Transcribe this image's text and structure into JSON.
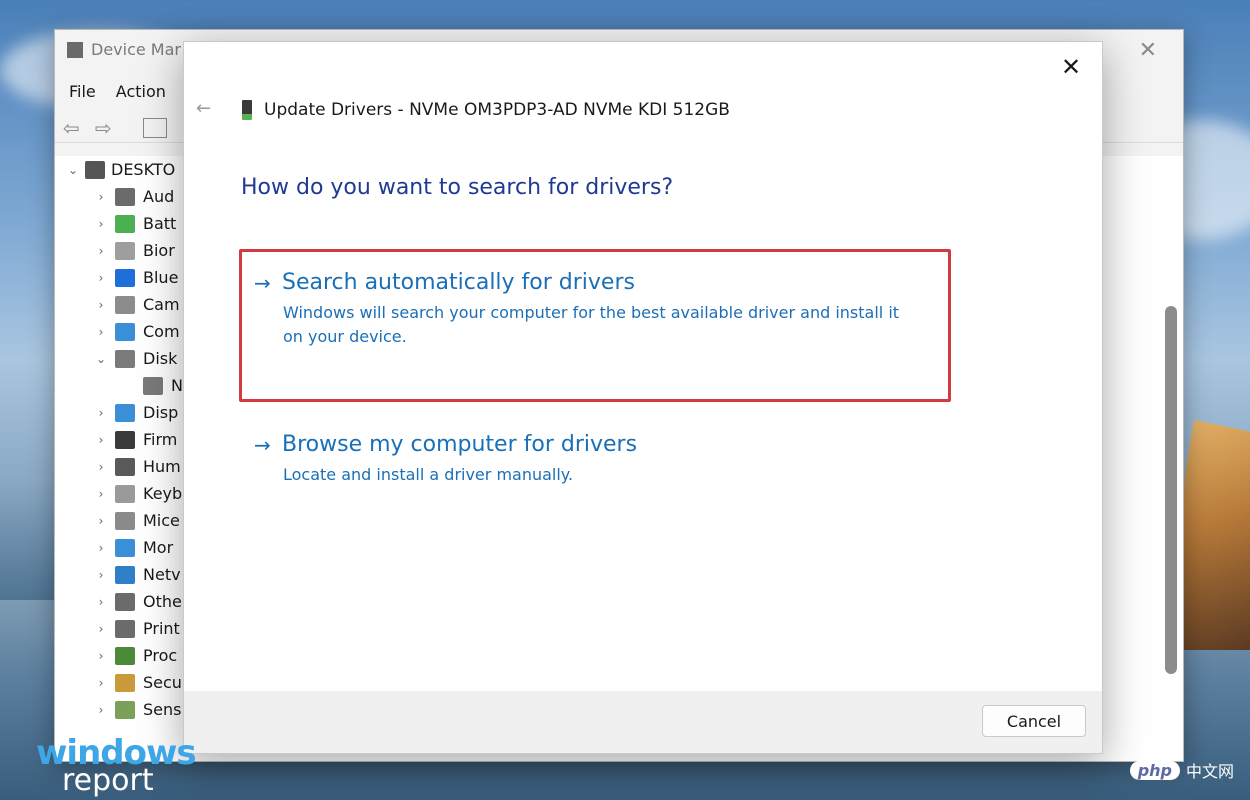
{
  "device_manager": {
    "title": "Device Mar",
    "menu": [
      "File",
      "Action"
    ],
    "tree_root": "DESKTO",
    "tree_items": [
      {
        "label": "Aud",
        "color": "#6b6b6b",
        "expanded": false
      },
      {
        "label": "Batt",
        "color": "#4caf50",
        "expanded": false
      },
      {
        "label": "Bior",
        "color": "#9e9e9e",
        "expanded": false
      },
      {
        "label": "Blue",
        "color": "#1e6fd9",
        "expanded": false
      },
      {
        "label": "Cam",
        "color": "#8c8c8c",
        "expanded": false
      },
      {
        "label": "Com",
        "color": "#3a8fd6",
        "expanded": false
      },
      {
        "label": "Disk",
        "color": "#7a7a7a",
        "expanded": true
      },
      {
        "label": "N",
        "color": "#7a7a7a",
        "expanded": false,
        "child": true
      },
      {
        "label": "Disp",
        "color": "#3a8fd6",
        "expanded": false
      },
      {
        "label": "Firm",
        "color": "#3a3a3a",
        "expanded": false
      },
      {
        "label": "Hum",
        "color": "#5a5a5a",
        "expanded": false
      },
      {
        "label": "Keyb",
        "color": "#9a9a9a",
        "expanded": false
      },
      {
        "label": "Mice",
        "color": "#8a8a8a",
        "expanded": false
      },
      {
        "label": "Mor",
        "color": "#3a8fd6",
        "expanded": false
      },
      {
        "label": "Netv",
        "color": "#2f7fc8",
        "expanded": false
      },
      {
        "label": "Othe",
        "color": "#6b6b6b",
        "expanded": false
      },
      {
        "label": "Print",
        "color": "#6b6b6b",
        "expanded": false
      },
      {
        "label": "Proc",
        "color": "#4a8a3a",
        "expanded": false
      },
      {
        "label": "Secu",
        "color": "#c89a3a",
        "expanded": false
      },
      {
        "label": "Sens",
        "color": "#7aa05a",
        "expanded": false
      }
    ]
  },
  "dialog": {
    "header": "Update Drivers - NVMe OM3PDP3-AD NVMe KDI 512GB",
    "question": "How do you want to search for drivers?",
    "options": [
      {
        "title": "Search automatically for drivers",
        "description": "Windows will search your computer for the best available driver and install it on your device."
      },
      {
        "title": "Browse my computer for drivers",
        "description": "Locate and install a driver manually."
      }
    ],
    "cancel_label": "Cancel",
    "close_glyph": "✕",
    "back_glyph": "←"
  },
  "watermark": {
    "line1": "windows",
    "line2": "report",
    "php": "php",
    "php_text": "中文网"
  },
  "colors": {
    "link_blue": "#1b6fb7",
    "heading_blue": "#1f3a93",
    "highlight_red": "#d13a3f"
  }
}
